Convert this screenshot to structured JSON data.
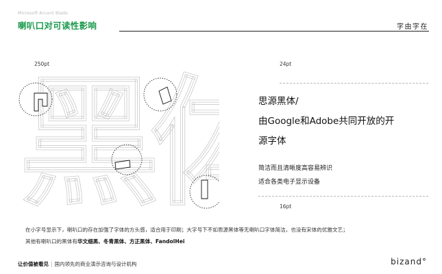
{
  "header": {
    "subtitle": "Microsoft Accent Blade",
    "title": "喇叭口对可读性影响",
    "logo_text": "字由字在"
  },
  "size_labels": {
    "large": "250pt",
    "medium": "24pt",
    "small": "16pt"
  },
  "artwork": {
    "glyph_text": "黑体"
  },
  "heading": {
    "line1": "思源黑体/",
    "line2": "由Google和Adobe共同开放的开",
    "line3": "源字体"
  },
  "features": [
    "简洁而且清晰度高容易辨识",
    "适合各类电子显示设备"
  ],
  "body": {
    "line1": "在小字号显示下，喇叭口的存在加强了字体的方头感，适合用于印刷；大字号下不如思源黑体等无喇叭口字体简洁，也没有宋体的优雅文艺；",
    "line2_prefix": "其他有喇叭口的黑体有",
    "line2_fonts": "华文细黑、冬青黑体、方正黑体、FandolHei"
  },
  "footer": {
    "slogan": "让价值被看见",
    "divider": "|",
    "description": "国内领先的商业演示咨询与设计机构",
    "brand": "bizand°"
  }
}
